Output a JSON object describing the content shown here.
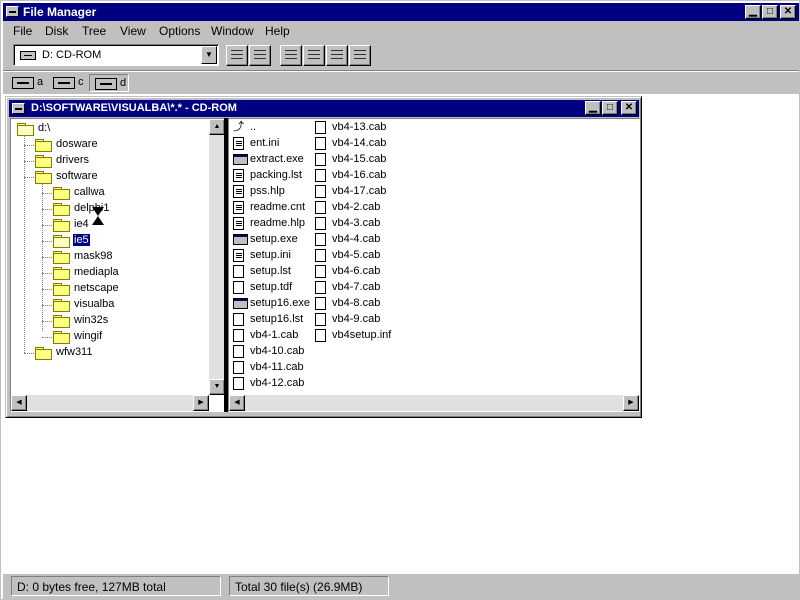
{
  "app": {
    "title": "File Manager"
  },
  "menu": {
    "items": [
      {
        "label": "File"
      },
      {
        "label": "Disk"
      },
      {
        "label": "Tree"
      },
      {
        "label": "View"
      },
      {
        "label": "Options"
      },
      {
        "label": "Window"
      },
      {
        "label": "Help"
      }
    ]
  },
  "toolbar": {
    "drive_select_value": "D: CD-ROM"
  },
  "drives": [
    {
      "letter": "a",
      "icon": "floppy-drive-icon"
    },
    {
      "letter": "c",
      "icon": "hard-drive-icon"
    },
    {
      "letter": "d",
      "icon": "cdrom-drive-icon",
      "selected": true
    }
  ],
  "child_window": {
    "title": "D:\\SOFTWARE\\VISUALBA\\*.* - CD-ROM"
  },
  "tree": [
    {
      "name": "d:\\",
      "level": 0
    },
    {
      "name": "dosware",
      "level": 1
    },
    {
      "name": "drivers",
      "level": 1
    },
    {
      "name": "software",
      "level": 1
    },
    {
      "name": "callwa",
      "level": 2
    },
    {
      "name": "delphi1",
      "level": 2
    },
    {
      "name": "ie4",
      "level": 2
    },
    {
      "name": "ie5",
      "level": 2,
      "selected": true
    },
    {
      "name": "mask98",
      "level": 2
    },
    {
      "name": "mediapla",
      "level": 2
    },
    {
      "name": "netscape",
      "level": 2
    },
    {
      "name": "visualba",
      "level": 2
    },
    {
      "name": "win32s",
      "level": 2
    },
    {
      "name": "wingif",
      "level": 2
    },
    {
      "name": "wfw311",
      "level": 1
    }
  ],
  "files": {
    "col1": [
      {
        "name": "..",
        "kind": "up"
      },
      {
        "name": "ent.ini",
        "kind": "doc"
      },
      {
        "name": "extract.exe",
        "kind": "exe"
      },
      {
        "name": "packing.lst",
        "kind": "doc"
      },
      {
        "name": "pss.hlp",
        "kind": "doc"
      },
      {
        "name": "readme.cnt",
        "kind": "doc"
      },
      {
        "name": "readme.hlp",
        "kind": "doc"
      },
      {
        "name": "setup.exe",
        "kind": "exe"
      },
      {
        "name": "setup.ini",
        "kind": "doc"
      },
      {
        "name": "setup.lst",
        "kind": "file"
      },
      {
        "name": "setup.tdf",
        "kind": "file"
      },
      {
        "name": "setup16.exe",
        "kind": "exe"
      },
      {
        "name": "setup16.lst",
        "kind": "file"
      },
      {
        "name": "vb4-1.cab",
        "kind": "file"
      },
      {
        "name": "vb4-10.cab",
        "kind": "file"
      },
      {
        "name": "vb4-11.cab",
        "kind": "file"
      },
      {
        "name": "vb4-12.cab",
        "kind": "file"
      }
    ],
    "col2": [
      {
        "name": "vb4-13.cab",
        "kind": "file"
      },
      {
        "name": "vb4-14.cab",
        "kind": "file"
      },
      {
        "name": "vb4-15.cab",
        "kind": "file"
      },
      {
        "name": "vb4-16.cab",
        "kind": "file"
      },
      {
        "name": "vb4-17.cab",
        "kind": "file"
      },
      {
        "name": "vb4-2.cab",
        "kind": "file"
      },
      {
        "name": "vb4-3.cab",
        "kind": "file"
      },
      {
        "name": "vb4-4.cab",
        "kind": "file"
      },
      {
        "name": "vb4-5.cab",
        "kind": "file"
      },
      {
        "name": "vb4-6.cab",
        "kind": "file"
      },
      {
        "name": "vb4-7.cab",
        "kind": "file"
      },
      {
        "name": "vb4-8.cab",
        "kind": "file"
      },
      {
        "name": "vb4-9.cab",
        "kind": "file"
      },
      {
        "name": "vb4setup.inf",
        "kind": "file"
      }
    ]
  },
  "status": {
    "disk": "D: 0 bytes free,  127MB total",
    "files": "Total 30 file(s) (26.9MB)"
  },
  "colors": {
    "title_bar": "#000080",
    "face": "#c0c0c0",
    "folder": "#ffff80"
  }
}
